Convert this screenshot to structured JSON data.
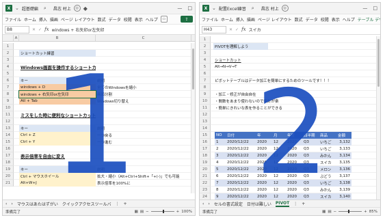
{
  "left_window": {
    "title": "超基礎編",
    "user": "昌志 村上",
    "menu": [
      "ファイル",
      "ホーム",
      "挿入",
      "描画",
      "ページ レイアウト",
      "数式",
      "データ",
      "校閲",
      "表示",
      "ヘルプ"
    ],
    "namebox": "B8",
    "formula": "windows + 右矢印or左矢印",
    "columns": [
      "A",
      "B",
      "C"
    ],
    "rows": [
      {
        "n": "1",
        "cells": []
      },
      {
        "n": "2",
        "cells": [
          {
            "t": "ショートカット練習",
            "style": "blue",
            "col": "b"
          }
        ]
      },
      {
        "n": "3",
        "cells": []
      },
      {
        "n": "4",
        "cells": [
          {
            "t": "Windows画面を操作するショートカット",
            "style": "bold-u",
            "col": "b"
          }
        ]
      },
      {
        "n": "5",
        "cells": []
      },
      {
        "n": "6",
        "cells": [
          {
            "t": "キー",
            "style": "blue",
            "col": "b"
          },
          {
            "t": "説明",
            "style": "",
            "col": "c"
          }
        ]
      },
      {
        "n": "7",
        "cells": [
          {
            "t": "windows + D",
            "style": "orange",
            "col": "b"
          },
          {
            "t": "全てのWindowsを縮小",
            "style": "",
            "col": "c"
          }
        ]
      },
      {
        "n": "8",
        "cells": [
          {
            "t": "windows + 右矢印or左矢印",
            "style": "orange-sel",
            "col": "b"
          },
          {
            "t": "画面分割",
            "style": "",
            "col": "c"
          }
        ]
      },
      {
        "n": "9",
        "cells": [
          {
            "t": "Atl + Tab",
            "style": "orange",
            "col": "b"
          },
          {
            "t": "Windows切り替え",
            "style": "",
            "col": "c"
          }
        ]
      },
      {
        "n": "10",
        "cells": []
      },
      {
        "n": "11",
        "cells": [
          {
            "t": "ミスをした時に便利なショートカット",
            "style": "bold-u",
            "col": "b"
          }
        ]
      },
      {
        "n": "12",
        "cells": []
      },
      {
        "n": "13",
        "cells": [
          {
            "t": "キー",
            "style": "blue",
            "col": "b"
          },
          {
            "t": "説明",
            "style": "",
            "col": "c"
          }
        ]
      },
      {
        "n": "14",
        "cells": [
          {
            "t": "Ctrl + Z",
            "style": "yellow",
            "col": "b"
          },
          {
            "t": "一つ戻る",
            "style": "",
            "col": "c"
          }
        ]
      },
      {
        "n": "15",
        "cells": [
          {
            "t": "Ctrl + Y",
            "style": "yellow",
            "col": "b"
          },
          {
            "t": "一つ進む",
            "style": "",
            "col": "c"
          }
        ]
      },
      {
        "n": "16",
        "cells": []
      },
      {
        "n": "17",
        "cells": [
          {
            "t": "表示倍率を自由に変え",
            "style": "bold-u",
            "col": "b"
          }
        ]
      },
      {
        "n": "18",
        "cells": []
      },
      {
        "n": "19",
        "cells": [
          {
            "t": "キー",
            "style": "blue",
            "col": "b"
          },
          {
            "t": "説明",
            "style": "",
            "col": "c"
          }
        ]
      },
      {
        "n": "20",
        "cells": [
          {
            "t": "Ctrl + マウスホイール",
            "style": "yellow",
            "col": "b"
          },
          {
            "t": "拡大・縮小（Alt+Ctrl+Shift+「+(-)」でも可能",
            "style": "",
            "col": "c"
          }
        ]
      },
      {
        "n": "21",
        "cells": [
          {
            "t": "Alt+W+J",
            "style": "yellow",
            "col": "b"
          },
          {
            "t": "表示倍率を100%に",
            "style": "",
            "col": "c"
          }
        ]
      }
    ],
    "sheet_tabs": [
      "マウスはあたはずがい",
      "クイックアクセスツールバ"
    ],
    "status": "準備完了",
    "zoom": "100%",
    "zoom_fraction": 0.5
  },
  "right_window": {
    "title": "配置Excel練習",
    "user": "昌志 村上",
    "menu": [
      "ファイル",
      "ホーム",
      "挿入",
      "描画",
      "ページ レイアウト",
      "数式",
      "データ",
      "校閲",
      "表示",
      "ヘルプ",
      "テーブル デザイン"
    ],
    "namebox": "H43",
    "formula": "スイカ",
    "rows_top": [
      {
        "n": "1",
        "t": ""
      },
      {
        "n": "2",
        "t": "PIVOTを理解しよう",
        "style": "blue"
      },
      {
        "n": "3",
        "t": ""
      },
      {
        "n": "4",
        "t": "ショートカット",
        "style": "u"
      },
      {
        "n": "5",
        "t": "Alt→N→V→T"
      },
      {
        "n": "6",
        "t": ""
      },
      {
        "n": "7",
        "t": "ピボットテーブルはデータ加工を簡単にするためのツールです！！！"
      },
      {
        "n": "8",
        "t": ""
      },
      {
        "n": "9",
        "t": "・加工・修正が自由自在"
      },
      {
        "n": "10",
        "t": "・間数をあまり使わないので集計が楽"
      },
      {
        "n": "11",
        "t": "・簡単にきれいな表を作ることができる"
      },
      {
        "n": "12",
        "t": ""
      },
      {
        "n": "13",
        "t": ""
      },
      {
        "n": "14",
        "t": ""
      }
    ],
    "table_headers": [
      "NO",
      "日付",
      "年",
      "月",
      "年度",
      "四半期",
      "商品",
      "金額"
    ],
    "table_rows": [
      [
        "1",
        "2020/12/22",
        "2020",
        "12",
        "2020",
        "Q3",
        "いちご",
        "3,132"
      ],
      [
        "2",
        "2020/12/22",
        "2020",
        "12",
        "2020",
        "Q3",
        "いちご",
        "3,133"
      ],
      [
        "3",
        "2020/12/22",
        "2020",
        "12",
        "2020",
        "Q3",
        "みかん",
        "3,134"
      ],
      [
        "4",
        "2020/12/22",
        "2020",
        "12",
        "2020",
        "Q3",
        "スイカ",
        "3,135"
      ],
      [
        "5",
        "2020/12/22",
        "2020",
        "12",
        "2020",
        "Q3",
        "メロン",
        "3,136"
      ],
      [
        "6",
        "2020/12/22",
        "2020",
        "12",
        "2020",
        "Q3",
        "ぶどう",
        "3,137"
      ],
      [
        "7",
        "2020/12/22",
        "2020",
        "12",
        "2020",
        "Q3",
        "いちご",
        "3,138"
      ],
      [
        "8",
        "2020/12/22",
        "2020",
        "12",
        "2020",
        "Q3",
        "みかん",
        "3,139"
      ],
      [
        "9",
        "2020/12/22",
        "2020",
        "12",
        "2020",
        "Q3",
        "スイカ",
        "3,140"
      ]
    ],
    "table_row_numbers": [
      "15",
      "16",
      "17",
      "18",
      "19",
      "20",
      "21",
      "22",
      "23",
      "24"
    ],
    "sheet_tabs": [
      "セルの書式設定",
      "日付は難しい",
      "PIVOT"
    ],
    "active_tab": "PIVOT",
    "status": "準備完了",
    "zoom": "85%",
    "zoom_fraction": 0.42
  },
  "overlay": {
    "left_number": "1",
    "right_number": "2",
    "color": "#1b4fbf"
  },
  "icons": {
    "new_sheet": "+",
    "more": "⋮",
    "left_arrow": "‹",
    "right_arrow": "›"
  }
}
